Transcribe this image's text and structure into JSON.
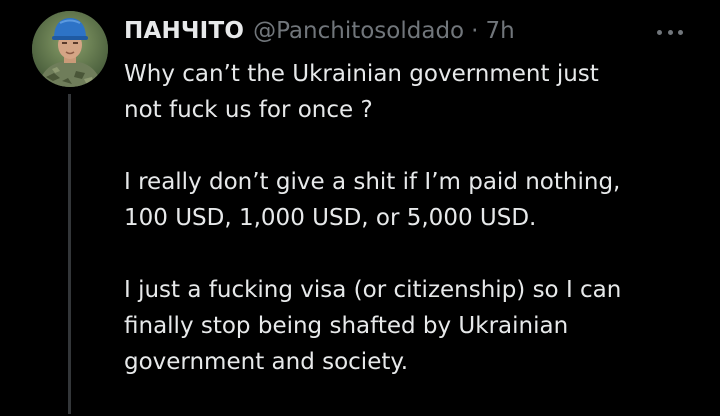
{
  "tweet": {
    "display_name": "ПАНЧІТО",
    "handle": "@Panchitosoldado",
    "separator": "·",
    "time": "7h",
    "paragraphs": [
      [
        "Why can’t the Ukrainian government just",
        "not fuck us for once ?"
      ],
      [
        "I really don’t give a shit if I’m paid nothing,",
        "100 USD, 1,000 USD, or 5,000 USD."
      ],
      [
        "I just a fucking visa (or citizenship) so I can",
        "finally stop being shafted by Ukrainian",
        "government and society."
      ]
    ]
  },
  "icons": {
    "avatar": "profile-photo-soldier-blue-helmet",
    "more": "more-horizontal-icon"
  },
  "colors": {
    "background": "#000000",
    "primary_text": "#e7e9ea",
    "secondary_text": "#71767b",
    "thread_line": "#333639"
  }
}
